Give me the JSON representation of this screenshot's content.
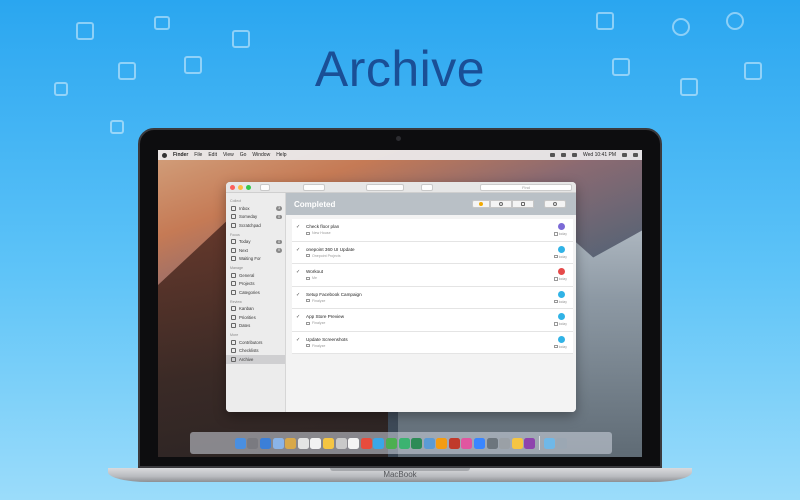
{
  "headline": "Archive",
  "colors": {
    "background_top": "#2aa6f0",
    "headline": "#1a4f96",
    "header_bar": "#b9c0c6"
  },
  "laptop": {
    "brand": "MacBook"
  },
  "menubar": {
    "items": [
      "Finder",
      "File",
      "Edit",
      "View",
      "Go",
      "Window",
      "Help"
    ],
    "clock": "Wed 10:41 PM"
  },
  "app": {
    "search_placeholder": "Find",
    "header_title": "Completed",
    "sidebar": [
      {
        "title": "Collect",
        "items": [
          {
            "label": "Inbox",
            "badge": "3",
            "icon": "inbox-icon"
          },
          {
            "label": "Someday",
            "badge": "0",
            "icon": "someday-icon"
          },
          {
            "label": "Scratchpad",
            "badge": "",
            "icon": "scratchpad-icon"
          }
        ]
      },
      {
        "title": "Focus",
        "items": [
          {
            "label": "Today",
            "badge": "0",
            "icon": "star-icon"
          },
          {
            "label": "Next",
            "badge": "0",
            "icon": "next-icon"
          },
          {
            "label": "Waiting For",
            "badge": "",
            "icon": "waiting-icon"
          }
        ]
      },
      {
        "title": "Manage",
        "items": [
          {
            "label": "General",
            "badge": "",
            "icon": "general-icon"
          },
          {
            "label": "Projects",
            "badge": "",
            "icon": "projects-icon"
          },
          {
            "label": "Categories",
            "badge": "",
            "icon": "categories-icon"
          }
        ]
      },
      {
        "title": "Review",
        "items": [
          {
            "label": "Kanban",
            "badge": "",
            "icon": "kanban-icon"
          },
          {
            "label": "Priorities",
            "badge": "",
            "icon": "priorities-icon"
          },
          {
            "label": "Dates",
            "badge": "",
            "icon": "dates-icon"
          }
        ]
      },
      {
        "title": "More",
        "items": [
          {
            "label": "Contributors",
            "badge": "",
            "icon": "contributors-icon"
          },
          {
            "label": "Checklists",
            "badge": "",
            "icon": "checklists-icon"
          },
          {
            "label": "Archive",
            "badge": "",
            "icon": "archive-icon",
            "active": true
          }
        ]
      }
    ],
    "tasks": [
      {
        "title": "Check floor plan",
        "project": "New House",
        "avatar_color": "#7b6ad6",
        "avatar": "",
        "date": "today"
      },
      {
        "title": "onepoint 360 UI Update",
        "project": "Onepoint Projects",
        "avatar_color": "#31b3e6",
        "avatar": "",
        "date": "today"
      },
      {
        "title": "Workout",
        "project": "Me",
        "avatar_color": "#e54a4a",
        "avatar": "",
        "date": "today"
      },
      {
        "title": "Setup Facebook Campaign",
        "project": "Finalyze",
        "avatar_color": "#31b3e6",
        "avatar": "",
        "date": "today"
      },
      {
        "title": "App Store Preview",
        "project": "Finalyze",
        "avatar_color": "#31b3e6",
        "avatar": "",
        "date": "today"
      },
      {
        "title": "Update Screenshots",
        "project": "Finalyze",
        "avatar_color": "#31b3e6",
        "avatar": "",
        "date": "today"
      }
    ]
  },
  "dock_colors": [
    "#4a8fe0",
    "#7a7a80",
    "#3b7fd8",
    "#8ab4e8",
    "#d8a84a",
    "#e4e4e4",
    "#f2f2f2",
    "#f5c542",
    "#c9c9c9",
    "#f4f4f4",
    "#e74c3c",
    "#3aa7e8",
    "#4caf50",
    "#3cb371",
    "#2e8b57",
    "#5b9bd5",
    "#f39c12",
    "#c0392b",
    "#e056a0",
    "#3a86ff",
    "#6c757d",
    "#9aa0a6",
    "#f5c542",
    "#8e44ad",
    "#6fb8e8",
    "#9ba7b3"
  ]
}
